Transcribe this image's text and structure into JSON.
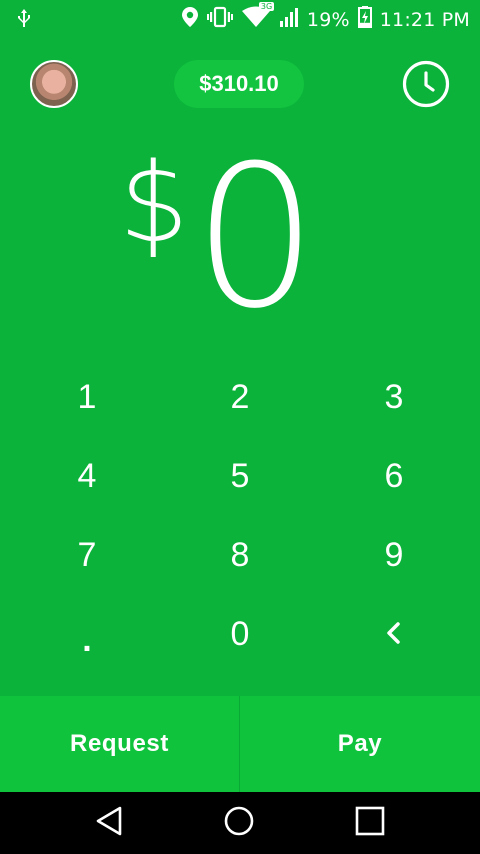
{
  "status_bar": {
    "usb_icon": "usb-icon",
    "location_icon": "location-icon",
    "vibrate_icon": "vibrate-icon",
    "wifi_icon": "wifi-icon",
    "network_type": "3G",
    "signal_icon": "signal-icon",
    "battery_percent_text": "19%",
    "battery_level": 0.19,
    "battery_icon": "battery-charging-icon",
    "time": "11:21 PM"
  },
  "header": {
    "avatar_icon": "profile-avatar",
    "balance": "$310.10",
    "history_icon": "clock-icon"
  },
  "amount": {
    "currency": "$",
    "value": "0"
  },
  "keypad": {
    "keys": [
      "1",
      "2",
      "3",
      "4",
      "5",
      "6",
      "7",
      "8",
      "9",
      ".",
      "0",
      "‹"
    ],
    "backspace_icon": "backspace-chevron-icon"
  },
  "actions": {
    "request_label": "Request",
    "pay_label": "Pay"
  },
  "navbar": {
    "back_icon": "back-triangle-icon",
    "home_icon": "home-circle-icon",
    "recents_icon": "recents-square-icon"
  },
  "colors": {
    "background": "#0bb33a",
    "pill": "#12c43f",
    "action_bar": "#10c33d",
    "nav": "#000000"
  }
}
